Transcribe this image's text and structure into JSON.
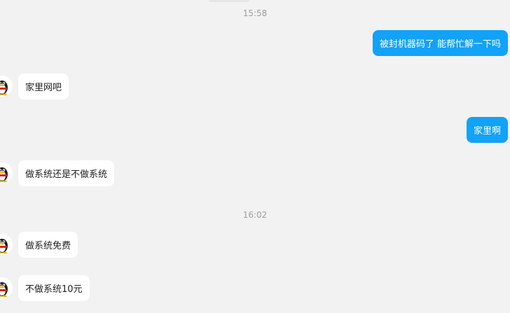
{
  "chat": {
    "timestamps": [
      "15:58",
      "16:02"
    ],
    "messages": [
      {
        "side": "out",
        "text": "被封机器码了 能帮忙解一下吗"
      },
      {
        "side": "in",
        "text": "家里网吧"
      },
      {
        "side": "out",
        "text": "家里啊"
      },
      {
        "side": "in",
        "text": "做系统还是不做系统"
      },
      {
        "side": "in",
        "text": "做系统免费"
      },
      {
        "side": "in",
        "text": "不做系统10元"
      }
    ]
  },
  "icons": {
    "contact_avatar": "qq-penguin-avatar-icon"
  },
  "colors": {
    "background": "#f2f2f2",
    "outgoing_bubble": "#12a2f8",
    "incoming_bubble": "#ffffff",
    "timestamp_text": "#9e9e9e"
  }
}
